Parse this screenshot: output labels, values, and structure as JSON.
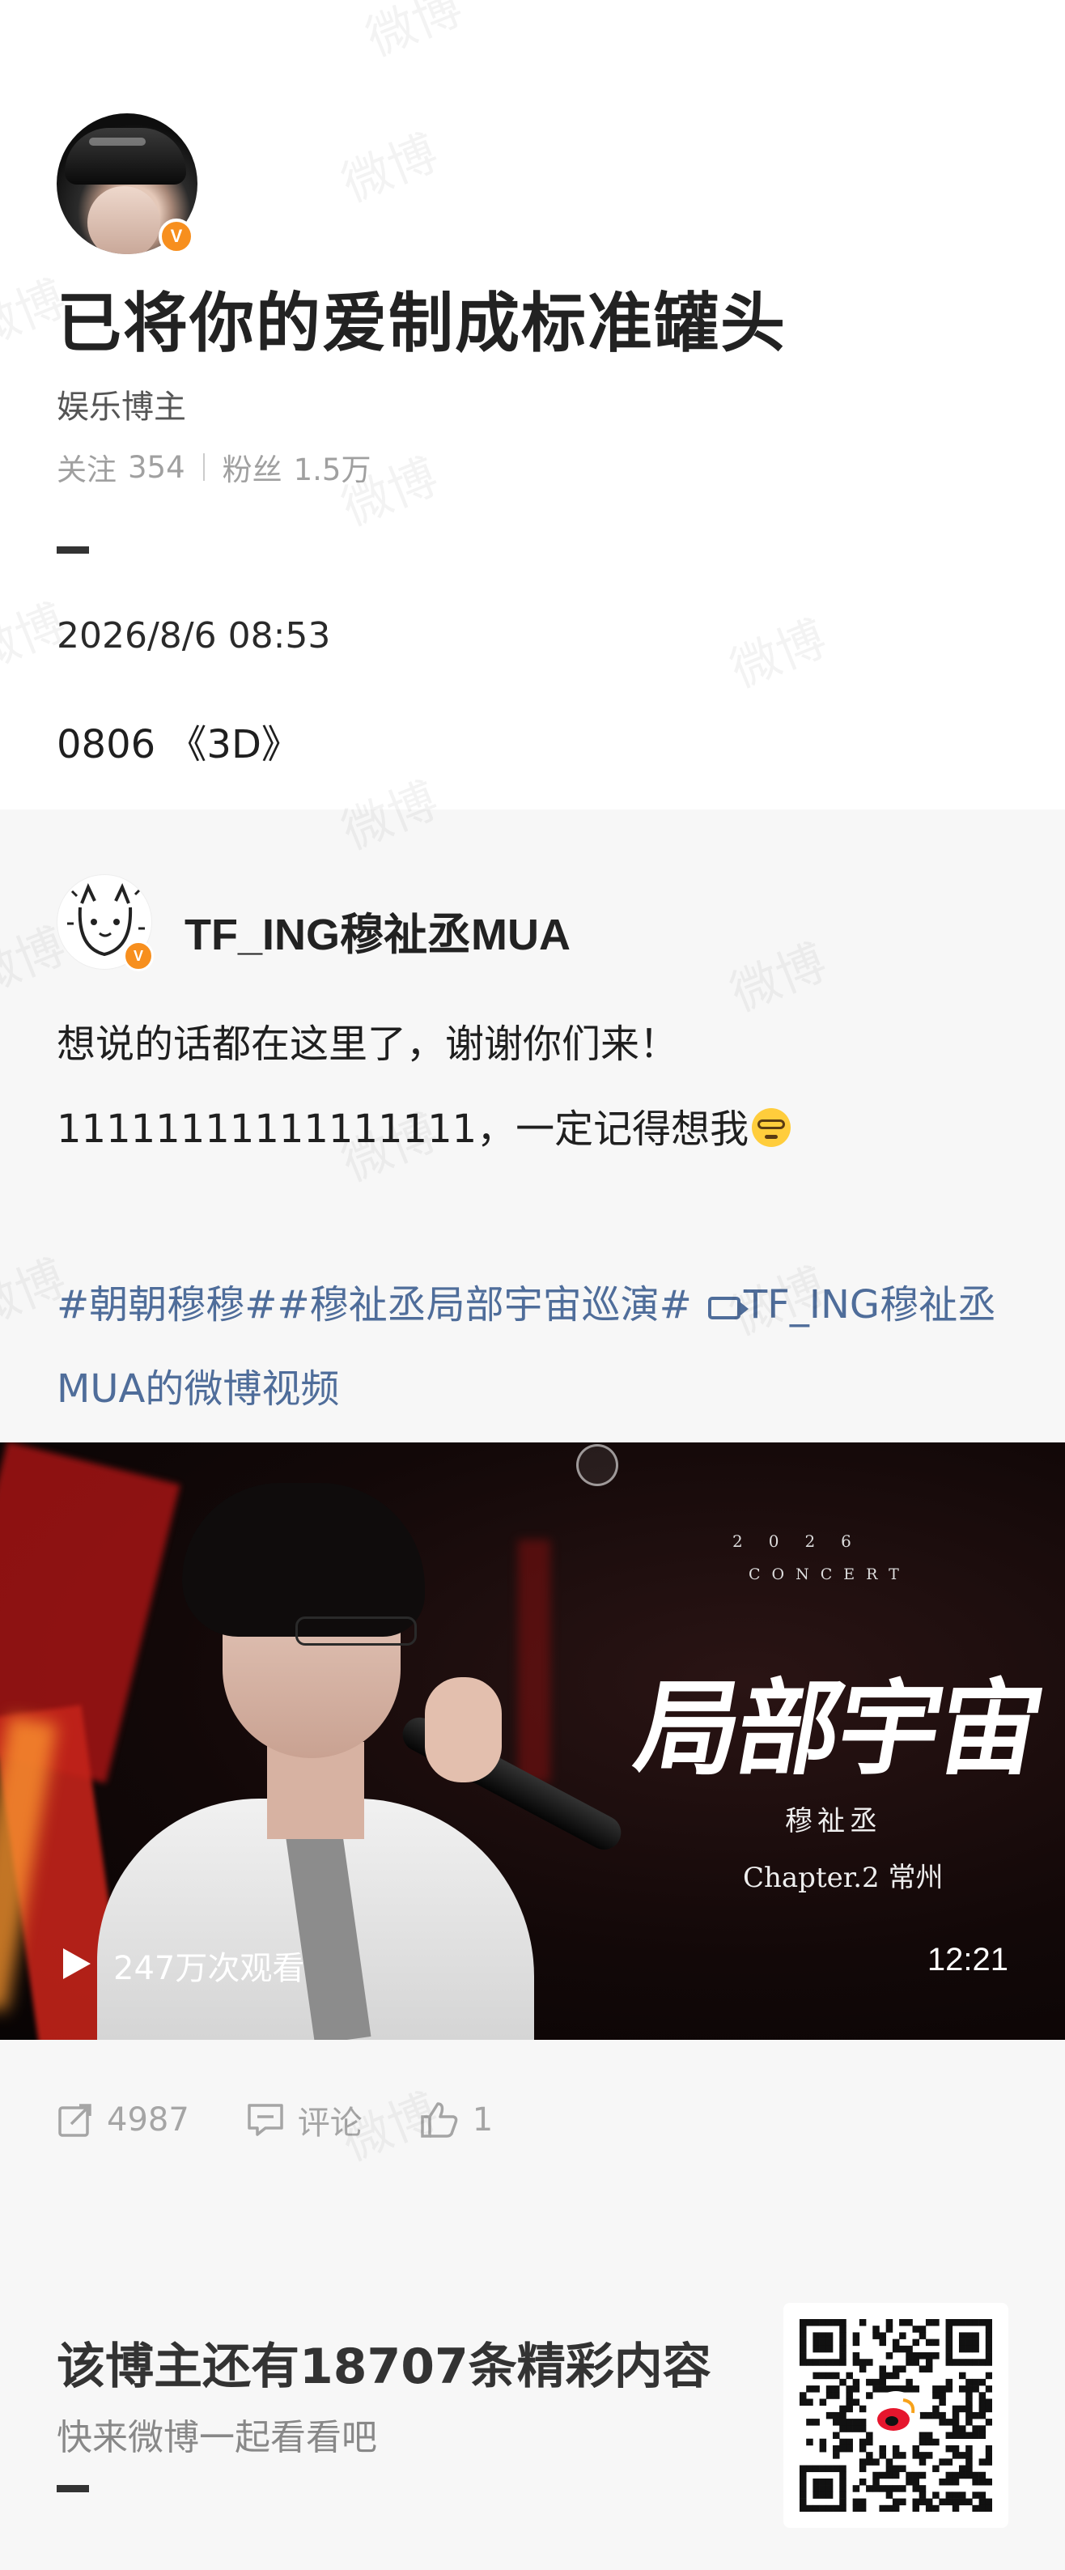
{
  "profile": {
    "name": "已将你的爱制成标准罐头",
    "category": "娱乐博主",
    "following_label": "关注",
    "following_count": "354",
    "followers_label": "粉丝",
    "followers_count": "1.5万",
    "verified_badge": "V"
  },
  "post": {
    "datetime": "2026/8/6 08:53",
    "text": "0806 《3D》"
  },
  "repost": {
    "author": "TF_ING穆祉丞MUA",
    "verified_badge": "V",
    "line1": "想说的话都在这里了，谢谢你们来！",
    "line2": "11111111111111111，一定记得想我",
    "emoji_icon": "nerd-face-emoji",
    "topic_text_1": "#朝朝穆穆##穆祉丞局部宇宙巡演#",
    "topic_link_text": "TF_ING穆祉丞MUA的微博视频",
    "video": {
      "concert_year": "2026",
      "concert_word": "CONCERT",
      "concert_title": "局部宇宙",
      "concert_artist": "穆祉丞",
      "concert_chapter": "Chapter.2 常州",
      "views": "247万次观看",
      "duration": "12:21"
    },
    "actions": {
      "repost_count": "4987",
      "comment_label": "评论",
      "like_count": "1"
    }
  },
  "promo": {
    "title": "该博主还有18707条精彩内容",
    "subtitle": "快来微博一起看看吧"
  },
  "theme": {
    "link_color": "#4f6d9a",
    "badge_color": "#f78f1e",
    "muted_color": "#a5a5a5"
  },
  "watermark_text": "微博"
}
